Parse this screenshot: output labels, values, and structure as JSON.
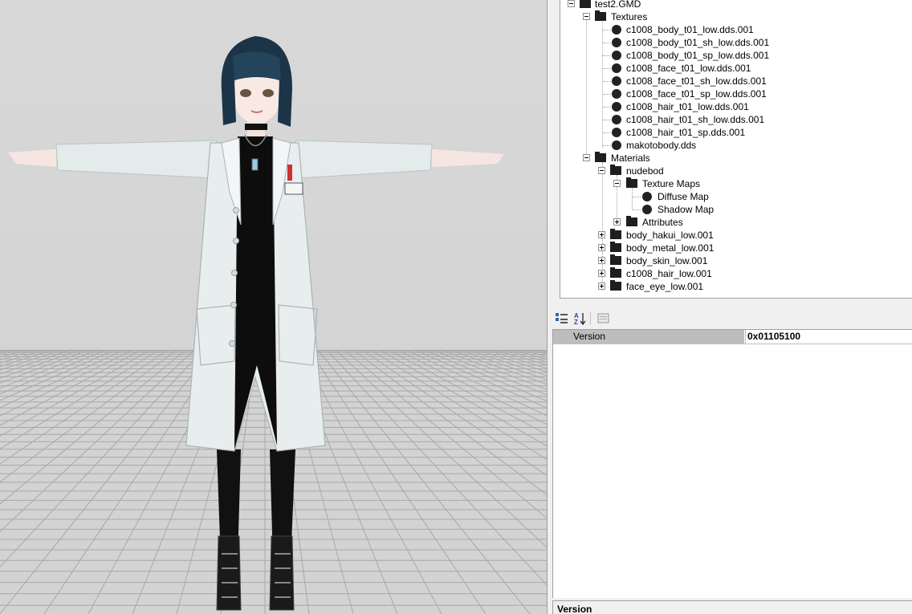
{
  "tree": {
    "root": "test2.GMD",
    "textures_label": "Textures",
    "textures": [
      "c1008_body_t01_low.dds.001",
      "c1008_body_t01_sh_low.dds.001",
      "c1008_body_t01_sp_low.dds.001",
      "c1008_face_t01_low.dds.001",
      "c1008_face_t01_sh_low.dds.001",
      "c1008_face_t01_sp_low.dds.001",
      "c1008_hair_t01_low.dds.001",
      "c1008_hair_t01_sh_low.dds.001",
      "c1008_hair_t01_sp.dds.001",
      "makotobody.dds"
    ],
    "materials_label": "Materials",
    "material_open": "nudebod",
    "texture_maps_label": "Texture Maps",
    "texture_maps": [
      "Diffuse Map",
      "Shadow Map"
    ],
    "attributes_label": "Attributes",
    "materials_collapsed": [
      "body_hakui_low.001",
      "body_metal_low.001",
      "body_skin_low.001",
      "c1008_hair_low.001",
      "face_eye_low.001"
    ]
  },
  "property_grid": {
    "toolbar": [
      "categorized-icon",
      "alphabetical-icon",
      "property-pages-icon"
    ],
    "rows": [
      {
        "name": "Version",
        "value": "0x01105100"
      }
    ],
    "help_title": "Version"
  },
  "colors": {
    "selection_gray": "#bdbdbd",
    "coat": "#e6ecec",
    "hair": "#1c3447",
    "grid": "#a8a8a8"
  }
}
